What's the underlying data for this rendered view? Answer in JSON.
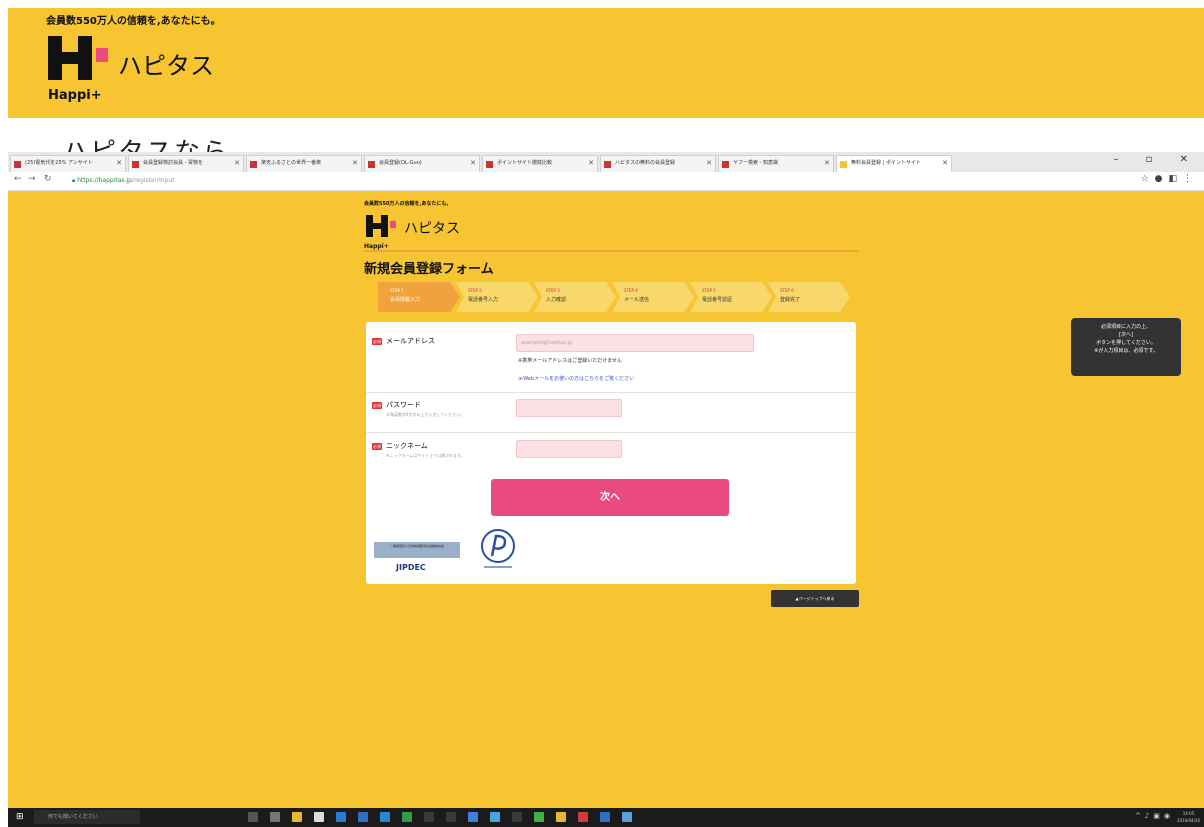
{
  "banner": {
    "tagline": "会員数550万人の信頼を,あなたにも。",
    "logo_kana": "ハピタス",
    "logo_en": "Happi+",
    "background_heading": "ハピタスなら"
  },
  "browser": {
    "tabs": [
      {
        "label": "(25)電気代を25% アンサイト"
      },
      {
        "label": "会員登録検討会員 - 買物を"
      },
      {
        "label": "楽天ふるさとの世界一番楽"
      },
      {
        "label": "会員登録(OL-Guu)"
      },
      {
        "label": "ポイントサイト徹底比較"
      },
      {
        "label": "ハピタスの無料の会員登録"
      },
      {
        "label": "ヤフー検索 - 知恵袋"
      },
      {
        "label": "無料会員登録 | ポイントサイト"
      }
    ],
    "url_domain": "https://happitas.jp",
    "url_path": "/register/input"
  },
  "page": {
    "tagline": "会員数550万人の信頼を,あなたにも。",
    "logo_kana": "ハピタス",
    "logo_en": "Happi+",
    "title": "新規会員登録フォーム",
    "steps": [
      {
        "num": "STEP 1",
        "label": "会員情報入力",
        "active": true
      },
      {
        "num": "STEP 2",
        "label": "電話番号入力",
        "active": false
      },
      {
        "num": "STEP 3",
        "label": "入力確認",
        "active": false
      },
      {
        "num": "STEP 4",
        "label": "メール送信",
        "active": false
      },
      {
        "num": "STEP 5",
        "label": "電話番号認証",
        "active": false
      },
      {
        "num": "STEP 6",
        "label": "登録完了",
        "active": false
      }
    ],
    "form": {
      "required_badge": "必須",
      "email_label": "メールアドレス",
      "email_value": "example@hapitas.jp",
      "email_note": "※携帯メールアドレスはご登録いただけません",
      "email_link": "≫Webメールをお使いの方はこちらをご覧ください",
      "password_label": "パスワード",
      "password_note": "半角英数字6文字以上で入力してください。",
      "nickname_label": "ニックネーム",
      "nickname_note": "※ニックネームはサイト上で公開されます。",
      "next_label": "次へ"
    },
    "jiipc_plate": "一般財団法人日本情報経済社会推進協会",
    "jiipc_text": "JIPDEC",
    "contact_label": "▲ページトップへ戻る",
    "tooltip": [
      "必須項目に入力の上、",
      "[次へ]",
      "ボタンを押してください。",
      "※が入力項目は、必須です。"
    ]
  },
  "taskbar": {
    "search_placeholder": "何でも聞いてください",
    "clock": "14:05",
    "date": "2016/04/20"
  },
  "colors": {
    "brand_yellow": "#f6c531",
    "brand_pink": "#e94a7f",
    "step_active": "#f0a23c"
  }
}
